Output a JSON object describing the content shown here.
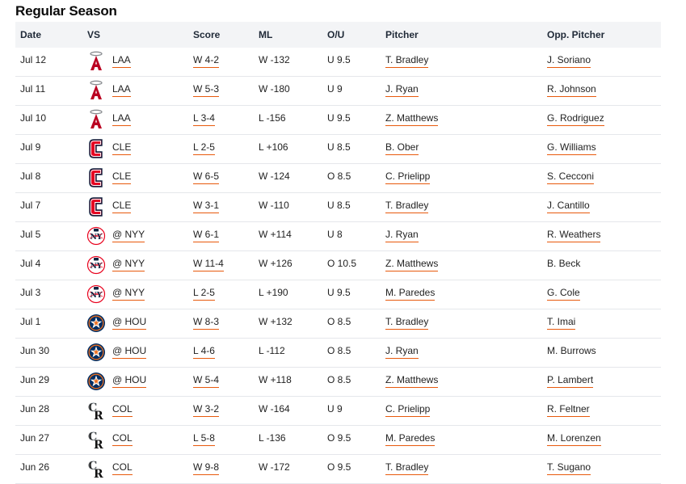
{
  "title": "Regular Season",
  "columns": {
    "date": "Date",
    "vs": "VS",
    "score": "Score",
    "ml": "ML",
    "ou": "O/U",
    "pitcher": "Pitcher",
    "opp_pitcher": "Opp. Pitcher"
  },
  "colors": {
    "accent_underline": "#e8590c",
    "header_bg": "#f3f4f6"
  },
  "games": [
    {
      "date": "Jul 12",
      "logo": "angels-logo-icon",
      "team": "LAA",
      "score": "W 4-2",
      "ml": "W -132",
      "ou": "U 9.5",
      "pitcher": "T. Bradley",
      "opp": "J. Soriano",
      "opp_link": true
    },
    {
      "date": "Jul 11",
      "logo": "angels-logo-icon",
      "team": "LAA",
      "score": "W 5-3",
      "ml": "W -180",
      "ou": "U 9",
      "pitcher": "J. Ryan",
      "opp": "R. Johnson",
      "opp_link": true
    },
    {
      "date": "Jul 10",
      "logo": "angels-logo-icon",
      "team": "LAA",
      "score": "L 3-4",
      "ml": "L -156",
      "ou": "U 9.5",
      "pitcher": "Z. Matthews",
      "opp": "G. Rodriguez",
      "opp_link": true
    },
    {
      "date": "Jul 9",
      "logo": "guardians-logo-icon",
      "team": "CLE",
      "score": "L 2-5",
      "ml": "L +106",
      "ou": "U 8.5",
      "pitcher": "B. Ober",
      "opp": "G. Williams",
      "opp_link": true
    },
    {
      "date": "Jul 8",
      "logo": "guardians-logo-icon",
      "team": "CLE",
      "score": "W 6-5",
      "ml": "W -124",
      "ou": "O 8.5",
      "pitcher": "C. Prielipp",
      "opp": "S. Cecconi",
      "opp_link": true
    },
    {
      "date": "Jul 7",
      "logo": "guardians-logo-icon",
      "team": "CLE",
      "score": "W 3-1",
      "ml": "W -110",
      "ou": "U 8.5",
      "pitcher": "T. Bradley",
      "opp": "J. Cantillo",
      "opp_link": true
    },
    {
      "date": "Jul 5",
      "logo": "yankees-logo-icon",
      "team": "@ NYY",
      "score": "W 6-1",
      "ml": "W +114",
      "ou": "U 8",
      "pitcher": "J. Ryan",
      "opp": "R. Weathers",
      "opp_link": true
    },
    {
      "date": "Jul 4",
      "logo": "yankees-logo-icon",
      "team": "@ NYY",
      "score": "W 11-4",
      "ml": "W +126",
      "ou": "O 10.5",
      "pitcher": "Z. Matthews",
      "opp": "B. Beck",
      "opp_link": false
    },
    {
      "date": "Jul 3",
      "logo": "yankees-logo-icon",
      "team": "@ NYY",
      "score": "L 2-5",
      "ml": "L +190",
      "ou": "U 9.5",
      "pitcher": "M. Paredes",
      "opp": "G. Cole",
      "opp_link": true
    },
    {
      "date": "Jul 1",
      "logo": "astros-logo-icon",
      "team": "@ HOU",
      "score": "W 8-3",
      "ml": "W +132",
      "ou": "O 8.5",
      "pitcher": "T. Bradley",
      "opp": "T. Imai",
      "opp_link": true
    },
    {
      "date": "Jun 30",
      "logo": "astros-logo-icon",
      "team": "@ HOU",
      "score": "L 4-6",
      "ml": "L -112",
      "ou": "O 8.5",
      "pitcher": "J. Ryan",
      "opp": "M. Burrows",
      "opp_link": false
    },
    {
      "date": "Jun 29",
      "logo": "astros-logo-icon",
      "team": "@ HOU",
      "score": "W 5-4",
      "ml": "W +118",
      "ou": "O 8.5",
      "pitcher": "Z. Matthews",
      "opp": "P. Lambert",
      "opp_link": true
    },
    {
      "date": "Jun 28",
      "logo": "rockies-logo-icon",
      "team": "COL",
      "score": "W 3-2",
      "ml": "W -164",
      "ou": "U 9",
      "pitcher": "C. Prielipp",
      "opp": "R. Feltner",
      "opp_link": true
    },
    {
      "date": "Jun 27",
      "logo": "rockies-logo-icon",
      "team": "COL",
      "score": "L 5-8",
      "ml": "L -136",
      "ou": "O 9.5",
      "pitcher": "M. Paredes",
      "opp": "M. Lorenzen",
      "opp_link": true
    },
    {
      "date": "Jun 26",
      "logo": "rockies-logo-icon",
      "team": "COL",
      "score": "W 9-8",
      "ml": "W -172",
      "ou": "O 9.5",
      "pitcher": "T. Bradley",
      "opp": "T. Sugano",
      "opp_link": true
    }
  ]
}
